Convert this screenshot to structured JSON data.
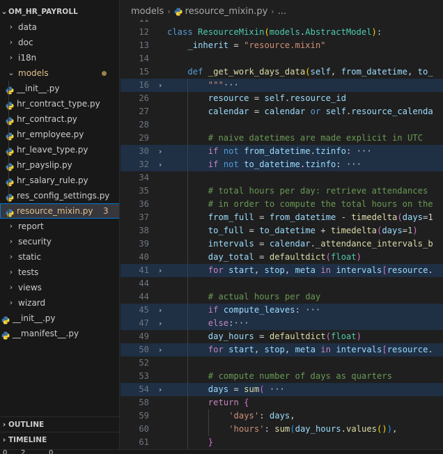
{
  "explorer": {
    "root": "OM_HR_PAYROLL",
    "items": [
      {
        "type": "folder",
        "label": "data",
        "depth": 0,
        "open": false
      },
      {
        "type": "folder",
        "label": "doc",
        "depth": 0,
        "open": false
      },
      {
        "type": "folder",
        "label": "i18n",
        "depth": 0,
        "open": false
      },
      {
        "type": "folder",
        "label": "models",
        "depth": 0,
        "open": true,
        "modified": true
      },
      {
        "type": "file",
        "label": "__init__.py",
        "depth": 1
      },
      {
        "type": "file",
        "label": "hr_contract_type.py",
        "depth": 1
      },
      {
        "type": "file",
        "label": "hr_contract.py",
        "depth": 1
      },
      {
        "type": "file",
        "label": "hr_employee.py",
        "depth": 1
      },
      {
        "type": "file",
        "label": "hr_leave_type.py",
        "depth": 1
      },
      {
        "type": "file",
        "label": "hr_payslip.py",
        "depth": 1
      },
      {
        "type": "file",
        "label": "hr_salary_rule.py",
        "depth": 1
      },
      {
        "type": "file",
        "label": "res_config_settings.py",
        "depth": 1
      },
      {
        "type": "file",
        "label": "resource_mixin.py",
        "depth": 1,
        "active": true,
        "modified": true,
        "badge": "3"
      },
      {
        "type": "folder",
        "label": "report",
        "depth": 0,
        "open": false
      },
      {
        "type": "folder",
        "label": "security",
        "depth": 0,
        "open": false
      },
      {
        "type": "folder",
        "label": "static",
        "depth": 0,
        "open": false
      },
      {
        "type": "folder",
        "label": "tests",
        "depth": 0,
        "open": false
      },
      {
        "type": "folder",
        "label": "views",
        "depth": 0,
        "open": false
      },
      {
        "type": "folder",
        "label": "wizard",
        "depth": 0,
        "open": false
      },
      {
        "type": "file",
        "label": "__init__.py",
        "depth": 0
      },
      {
        "type": "file",
        "label": "__manifest__.py",
        "depth": 0
      }
    ]
  },
  "panels": {
    "outline": "OUTLINE",
    "timeline": "TIMELINE"
  },
  "breadcrumb": {
    "folder": "models",
    "file": "resource_mixin.py",
    "more": "..."
  },
  "status": {
    "errors": "0",
    "warnings": "2",
    "ports": "0"
  },
  "colors": {
    "accent": "#0078d4",
    "modified": "#e2c08d",
    "python_blue": "#3c78aa",
    "python_yellow": "#ffd43b"
  },
  "editor": {
    "lines": [
      {
        "n": "11",
        "t": []
      },
      {
        "n": "12",
        "t": [
          [
            "kw",
            "class "
          ],
          [
            "cls",
            "ResourceMixin"
          ],
          [
            "b1",
            "("
          ],
          [
            "cls",
            "models"
          ],
          [
            "op",
            "."
          ],
          [
            "cls",
            "AbstractModel"
          ],
          [
            "b1",
            ")"
          ],
          [
            "op",
            ":"
          ]
        ]
      },
      {
        "n": "13",
        "ind": 1,
        "t": [
          [
            "var",
            "_inherit"
          ],
          [
            "op",
            " = "
          ],
          [
            "str",
            "\"resource.mixin\""
          ]
        ]
      },
      {
        "n": "14",
        "t": []
      },
      {
        "n": "15",
        "ind": 1,
        "t": [
          [
            "kw",
            "def "
          ],
          [
            "fn",
            "_get_work_days_data"
          ],
          [
            "b1",
            "("
          ],
          [
            "var",
            "self"
          ],
          [
            "op",
            ", "
          ],
          [
            "var",
            "from_datetime"
          ],
          [
            "op",
            ", "
          ],
          [
            "var",
            "to_"
          ]
        ]
      },
      {
        "n": "16",
        "ind": 2,
        "fold": true,
        "hl": true,
        "t": [
          [
            "str",
            "\"\"\""
          ],
          [
            "ell",
            "···"
          ]
        ]
      },
      {
        "n": "26",
        "ind": 2,
        "t": [
          [
            "var",
            "resource"
          ],
          [
            "op",
            " = "
          ],
          [
            "var",
            "self"
          ],
          [
            "op",
            "."
          ],
          [
            "var",
            "resource_id"
          ]
        ]
      },
      {
        "n": "27",
        "ind": 2,
        "t": [
          [
            "var",
            "calendar"
          ],
          [
            "op",
            " = "
          ],
          [
            "var",
            "calendar"
          ],
          [
            "op",
            " "
          ],
          [
            "kw",
            "or"
          ],
          [
            "op",
            " "
          ],
          [
            "var",
            "self"
          ],
          [
            "op",
            "."
          ],
          [
            "var",
            "resource_calenda"
          ]
        ]
      },
      {
        "n": "28",
        "ind": 2,
        "t": []
      },
      {
        "n": "29",
        "ind": 2,
        "t": [
          [
            "cm",
            "# naive datetimes are made explicit in UTC"
          ]
        ]
      },
      {
        "n": "30",
        "ind": 2,
        "fold": true,
        "hl": true,
        "t": [
          [
            "kc",
            "if"
          ],
          [
            "op",
            " "
          ],
          [
            "kw",
            "not"
          ],
          [
            "op",
            " "
          ],
          [
            "var",
            "from_datetime"
          ],
          [
            "op",
            "."
          ],
          [
            "var",
            "tzinfo"
          ],
          [
            "op",
            ": "
          ],
          [
            "ell",
            "···"
          ]
        ]
      },
      {
        "n": "32",
        "ind": 2,
        "fold": true,
        "hl": true,
        "t": [
          [
            "kc",
            "if"
          ],
          [
            "op",
            " "
          ],
          [
            "kw",
            "not"
          ],
          [
            "op",
            " "
          ],
          [
            "var",
            "to_datetime"
          ],
          [
            "op",
            "."
          ],
          [
            "var",
            "tzinfo"
          ],
          [
            "op",
            ": "
          ],
          [
            "ell",
            "···"
          ]
        ]
      },
      {
        "n": "34",
        "ind": 2,
        "t": []
      },
      {
        "n": "35",
        "ind": 2,
        "t": [
          [
            "cm",
            "# total hours per day: retrieve attendances"
          ]
        ]
      },
      {
        "n": "36",
        "ind": 2,
        "t": [
          [
            "cm",
            "# in order to compute the total hours on the"
          ]
        ]
      },
      {
        "n": "37",
        "ind": 2,
        "t": [
          [
            "var",
            "from_full"
          ],
          [
            "op",
            " = "
          ],
          [
            "var",
            "from_datetime"
          ],
          [
            "op",
            " - "
          ],
          [
            "fn",
            "timedelta"
          ],
          [
            "b2",
            "("
          ],
          [
            "var",
            "days"
          ],
          [
            "op",
            "=1"
          ]
        ]
      },
      {
        "n": "38",
        "ind": 2,
        "t": [
          [
            "var",
            "to_full"
          ],
          [
            "op",
            " = "
          ],
          [
            "var",
            "to_datetime"
          ],
          [
            "op",
            " + "
          ],
          [
            "fn",
            "timedelta"
          ],
          [
            "b2",
            "("
          ],
          [
            "var",
            "days"
          ],
          [
            "op",
            "="
          ],
          [
            "num",
            "1"
          ],
          [
            "b2",
            ")"
          ]
        ]
      },
      {
        "n": "39",
        "ind": 2,
        "t": [
          [
            "var",
            "intervals"
          ],
          [
            "op",
            " = "
          ],
          [
            "var",
            "calendar"
          ],
          [
            "op",
            "."
          ],
          [
            "fn",
            "_attendance_intervals_b"
          ]
        ]
      },
      {
        "n": "40",
        "ind": 2,
        "t": [
          [
            "var",
            "day_total"
          ],
          [
            "op",
            " = "
          ],
          [
            "fn",
            "defaultdict"
          ],
          [
            "b2",
            "("
          ],
          [
            "cls",
            "float"
          ],
          [
            "b2",
            ")"
          ]
        ]
      },
      {
        "n": "41",
        "ind": 2,
        "fold": true,
        "hl": true,
        "t": [
          [
            "kc",
            "for"
          ],
          [
            "op",
            " "
          ],
          [
            "var",
            "start"
          ],
          [
            "op",
            ", "
          ],
          [
            "var",
            "stop"
          ],
          [
            "op",
            ", "
          ],
          [
            "var",
            "meta"
          ],
          [
            "op",
            " "
          ],
          [
            "kc",
            "in"
          ],
          [
            "op",
            " "
          ],
          [
            "var",
            "intervals"
          ],
          [
            "b2",
            "["
          ],
          [
            "var",
            "resource"
          ],
          [
            "op",
            "."
          ]
        ]
      },
      {
        "n": "44",
        "ind": 2,
        "t": []
      },
      {
        "n": "44b",
        "ind": 2,
        "t": [
          [
            "cm",
            "# actual hours per day"
          ]
        ]
      },
      {
        "n": "45",
        "ind": 2,
        "fold": true,
        "hl": true,
        "t": [
          [
            "kc",
            "if"
          ],
          [
            "op",
            " "
          ],
          [
            "var",
            "compute_leaves"
          ],
          [
            "op",
            ": "
          ],
          [
            "ell",
            "···"
          ]
        ]
      },
      {
        "n": "47",
        "ind": 2,
        "fold": true,
        "hl": true,
        "t": [
          [
            "kc",
            "else"
          ],
          [
            "op",
            ":"
          ],
          [
            "ell",
            "···"
          ]
        ]
      },
      {
        "n": "49",
        "ind": 2,
        "t": [
          [
            "var",
            "day_hours"
          ],
          [
            "op",
            " = "
          ],
          [
            "fn",
            "defaultdict"
          ],
          [
            "b2",
            "("
          ],
          [
            "cls",
            "float"
          ],
          [
            "b2",
            ")"
          ]
        ]
      },
      {
        "n": "50",
        "ind": 2,
        "fold": true,
        "hl": true,
        "t": [
          [
            "kc",
            "for"
          ],
          [
            "op",
            " "
          ],
          [
            "var",
            "start"
          ],
          [
            "op",
            ", "
          ],
          [
            "var",
            "stop"
          ],
          [
            "op",
            ", "
          ],
          [
            "var",
            "meta"
          ],
          [
            "op",
            " "
          ],
          [
            "kc",
            "in"
          ],
          [
            "op",
            " "
          ],
          [
            "var",
            "intervals"
          ],
          [
            "b2",
            "["
          ],
          [
            "var",
            "resource"
          ],
          [
            "op",
            "."
          ]
        ]
      },
      {
        "n": "52",
        "ind": 2,
        "t": []
      },
      {
        "n": "53",
        "ind": 2,
        "t": [
          [
            "cm",
            "# compute number of days as quarters"
          ]
        ]
      },
      {
        "n": "54",
        "ind": 2,
        "fold": true,
        "hl": true,
        "t": [
          [
            "var",
            "days"
          ],
          [
            "op",
            " = "
          ],
          [
            "fn",
            "sum"
          ],
          [
            "b2",
            "("
          ],
          [
            "op",
            " "
          ],
          [
            "ell",
            "···"
          ]
        ]
      },
      {
        "n": "58",
        "ind": 2,
        "t": [
          [
            "kc",
            "return"
          ],
          [
            "op",
            " "
          ],
          [
            "b2",
            "{"
          ]
        ]
      },
      {
        "n": "59",
        "ind": 3,
        "t": [
          [
            "str",
            "'days'"
          ],
          [
            "op",
            ": "
          ],
          [
            "var",
            "days"
          ],
          [
            "op",
            ","
          ]
        ]
      },
      {
        "n": "60",
        "ind": 3,
        "t": [
          [
            "str",
            "'hours'"
          ],
          [
            "op",
            ": "
          ],
          [
            "fn",
            "sum"
          ],
          [
            "b3",
            "("
          ],
          [
            "var",
            "day_hours"
          ],
          [
            "op",
            "."
          ],
          [
            "fn",
            "values"
          ],
          [
            "b1",
            "()"
          ],
          [
            "b3",
            ")"
          ],
          [
            "op",
            ","
          ]
        ]
      },
      {
        "n": "61",
        "ind": 2,
        "t": [
          [
            "b2",
            "}"
          ]
        ]
      }
    ]
  }
}
